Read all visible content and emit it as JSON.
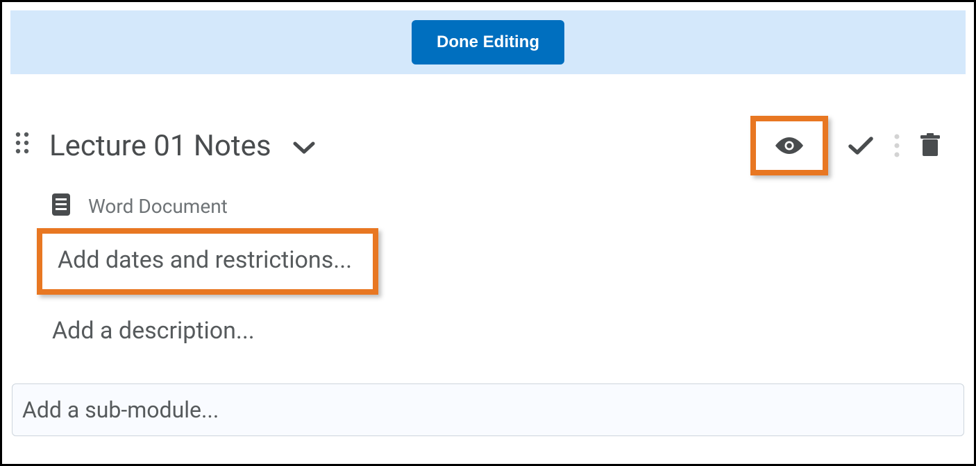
{
  "banner": {
    "done_button_label": "Done Editing"
  },
  "module": {
    "title": "Lecture 01 Notes",
    "document_type": "Word Document",
    "add_dates_label": "Add dates and restrictions...",
    "add_description_label": "Add a description..."
  },
  "submodule": {
    "placeholder": "Add a sub-module..."
  },
  "colors": {
    "highlight": "#e87722",
    "primary": "#006fbf",
    "banner_bg": "#d4e8fb"
  }
}
